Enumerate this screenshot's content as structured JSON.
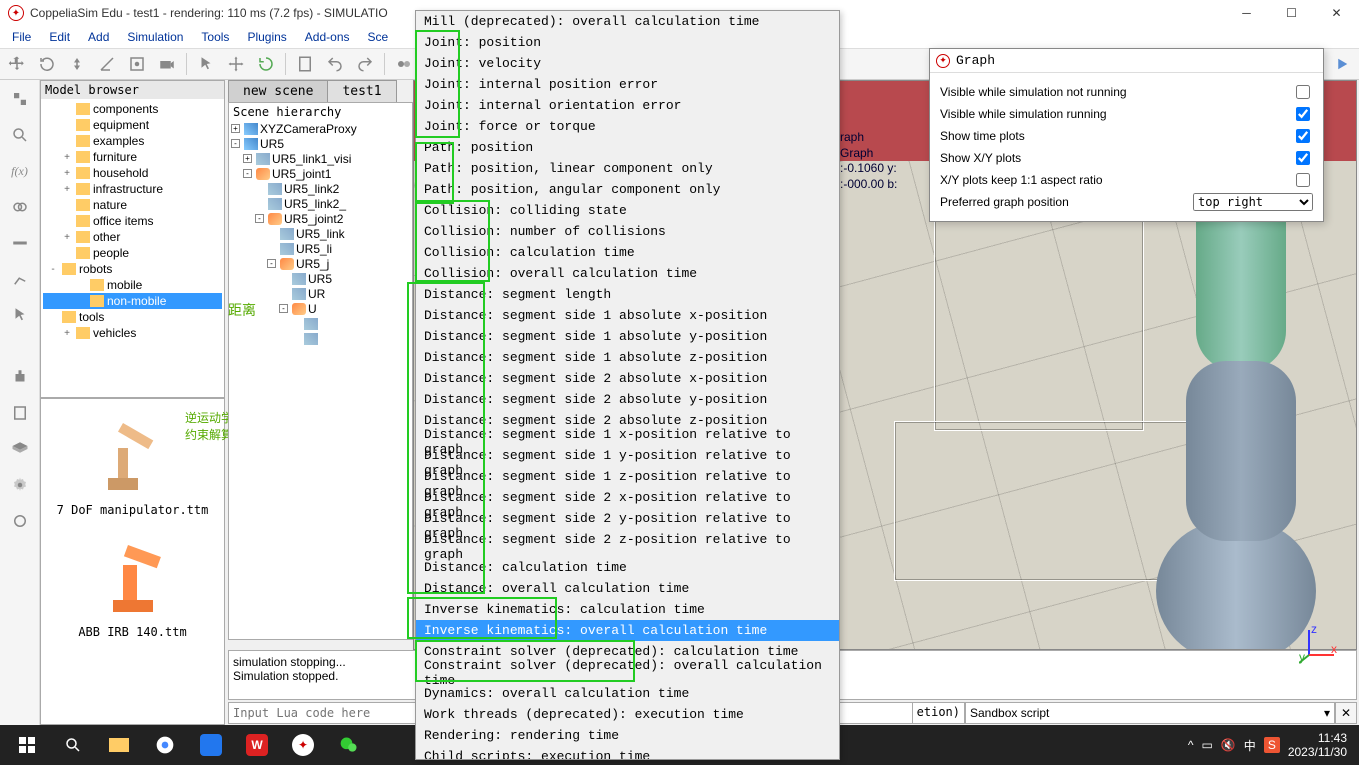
{
  "title": "CoppeliaSim Edu - test1 - rendering: 110 ms (7.2 fps) - SIMULATIO",
  "menus": [
    "File",
    "Edit",
    "Add",
    "Simulation",
    "Tools",
    "Plugins",
    "Add-ons",
    "Sce"
  ],
  "modelbrowser": {
    "title": "Model browser",
    "items": [
      {
        "ind": 1,
        "exp": "",
        "label": "components"
      },
      {
        "ind": 1,
        "exp": "",
        "label": "equipment"
      },
      {
        "ind": 1,
        "exp": "",
        "label": "examples"
      },
      {
        "ind": 1,
        "exp": "+",
        "label": "furniture"
      },
      {
        "ind": 1,
        "exp": "+",
        "label": "household"
      },
      {
        "ind": 1,
        "exp": "+",
        "label": "infrastructure"
      },
      {
        "ind": 1,
        "exp": "",
        "label": "nature"
      },
      {
        "ind": 1,
        "exp": "",
        "label": "office items"
      },
      {
        "ind": 1,
        "exp": "+",
        "label": "other"
      },
      {
        "ind": 1,
        "exp": "",
        "label": "people"
      },
      {
        "ind": 0,
        "exp": "-",
        "label": "robots"
      },
      {
        "ind": 2,
        "exp": "",
        "label": "mobile"
      },
      {
        "ind": 2,
        "exp": "",
        "label": "non-mobile",
        "sel": true
      },
      {
        "ind": 0,
        "exp": "",
        "label": "tools"
      },
      {
        "ind": 1,
        "exp": "+",
        "label": "vehicles"
      }
    ]
  },
  "thumbs": [
    {
      "label": "7 DoF manipulator.ttm"
    },
    {
      "label": "ABB IRB 140.ttm"
    }
  ],
  "annot_ik_line1": "逆运动学",
  "annot_ik_line2": "约束解算",
  "annot_dist": "距离",
  "tabs": [
    {
      "label": "new scene",
      "active": false
    },
    {
      "label": "test1",
      "active": true
    }
  ],
  "hierarchy": {
    "title": "Scene hierarchy",
    "rows": [
      {
        "ind": 0,
        "box": "+",
        "ico": "co",
        "label": "XYZCameraProxy"
      },
      {
        "ind": 0,
        "box": "-",
        "ico": "co",
        "label": "UR5"
      },
      {
        "ind": 1,
        "box": "+",
        "ico": "du",
        "label": "UR5_link1_visi"
      },
      {
        "ind": 1,
        "box": "-",
        "ico": "jo",
        "label": "UR5_joint1"
      },
      {
        "ind": 2,
        "box": "",
        "ico": "du",
        "label": "UR5_link2"
      },
      {
        "ind": 2,
        "box": "",
        "ico": "du",
        "label": "UR5_link2_"
      },
      {
        "ind": 2,
        "box": "-",
        "ico": "jo",
        "label": "UR5_joint2"
      },
      {
        "ind": 3,
        "box": "",
        "ico": "du",
        "label": "UR5_link"
      },
      {
        "ind": 3,
        "box": "",
        "ico": "du",
        "label": "UR5_li"
      },
      {
        "ind": 3,
        "box": "-",
        "ico": "jo",
        "label": "UR5_j"
      },
      {
        "ind": 4,
        "box": "",
        "ico": "du",
        "label": "UR5"
      },
      {
        "ind": 4,
        "box": "",
        "ico": "du",
        "label": "UR"
      },
      {
        "ind": 4,
        "box": "-",
        "ico": "jo",
        "label": "U"
      },
      {
        "ind": 5,
        "box": "",
        "ico": "du",
        "label": ""
      },
      {
        "ind": 5,
        "box": "",
        "ico": "du",
        "label": ""
      }
    ]
  },
  "popup_items": [
    "Mill (deprecated): overall calculation time",
    "Joint: position",
    "Joint: velocity",
    "Joint: internal position error",
    "Joint: internal orientation error",
    "Joint: force or torque",
    "Path: position",
    "Path: position, linear component only",
    "Path: position, angular component only",
    "Collision: colliding state",
    "Collision: number of collisions",
    "Collision: calculation time",
    "Collision: overall calculation time",
    "Distance: segment length",
    "Distance: segment side 1 absolute x-position",
    "Distance: segment side 1 absolute y-position",
    "Distance: segment side 1 absolute z-position",
    "Distance: segment side 2 absolute x-position",
    "Distance: segment side 2 absolute y-position",
    "Distance: segment side 2 absolute z-position",
    "Distance: segment side 1 x-position relative to graph",
    "Distance: segment side 1 y-position relative to graph",
    "Distance: segment side 1 z-position relative to graph",
    "Distance: segment side 2 x-position relative to graph",
    "Distance: segment side 2 y-position relative to graph",
    "Distance: segment side 2 z-position relative to graph",
    "Distance: calculation time",
    "Distance: overall calculation time",
    "Inverse kinematics: calculation time",
    "Inverse kinematics: overall calculation time",
    "Constraint solver (deprecated): calculation time",
    "Constraint solver (deprecated): overall calculation time",
    "Dynamics: overall calculation time",
    "Work threads (deprecated): execution time",
    "Rendering: rendering time",
    "Child scripts: execution time"
  ],
  "popup_selected_index": 29,
  "graph_dialog": {
    "title": "Graph",
    "rows": [
      {
        "label": "Visible while simulation not running",
        "checked": false
      },
      {
        "label": "Visible while simulation running",
        "checked": true
      },
      {
        "label": "Show time plots",
        "checked": true
      },
      {
        "label": "Show X/Y plots",
        "checked": true
      },
      {
        "label": "X/Y plots keep 1:1 aspect ratio",
        "checked": false
      }
    ],
    "pref_label": "Preferred graph position",
    "pref_value": "top right"
  },
  "viewport_overlay": {
    "l1": "raph",
    "l2": "Graph",
    "l3": ":-0.1060 y:",
    "l4": ":-000.00 b:"
  },
  "console": {
    "l1": "simulation stopping...",
    "l2": "Simulation stopped."
  },
  "cmd_placeholder": "Input Lua code here",
  "cmd_tail": "etion)",
  "script_label": "Sandbox script",
  "tray": {
    "time": "11:43",
    "date": "2023/11/30",
    "ime": "中",
    "s": "S"
  }
}
